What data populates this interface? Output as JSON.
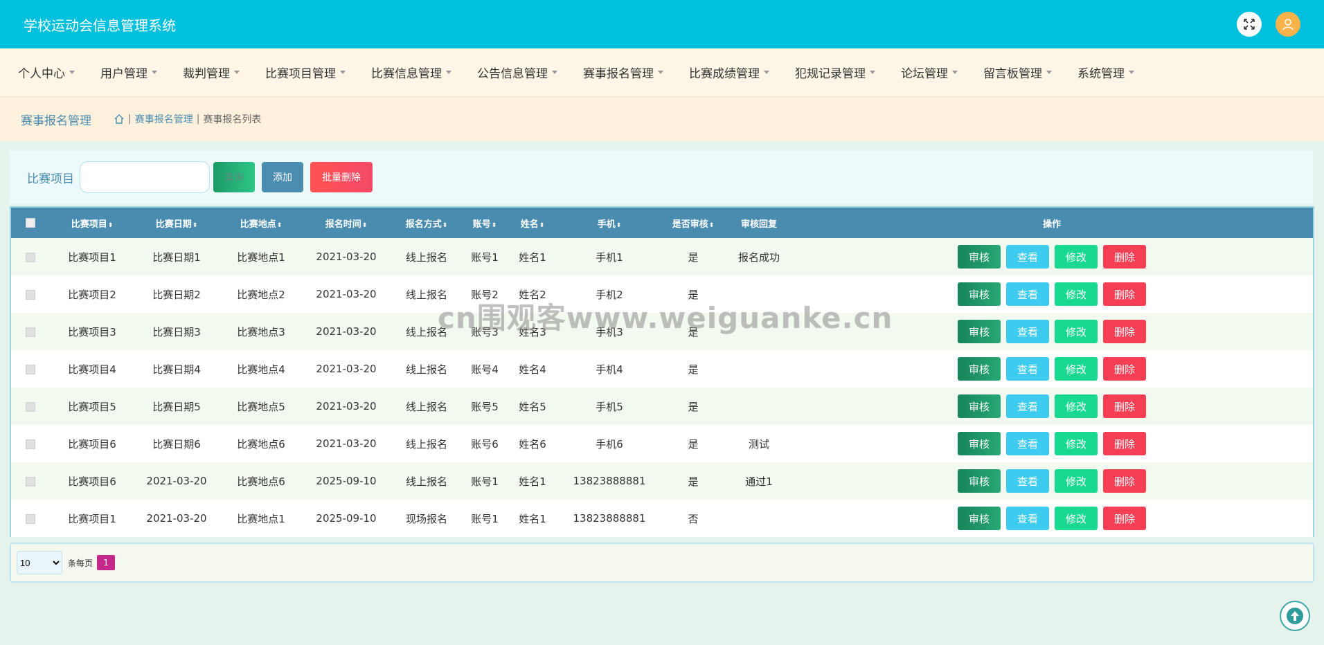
{
  "app": {
    "title": "学校运动会信息管理系统",
    "colors": {
      "header": "#00c0dd",
      "table_header": "#4a8cb0",
      "accent": "#4a8db1"
    }
  },
  "header": {
    "icons": [
      "fullscreen-icon",
      "user-avatar-icon"
    ]
  },
  "menu": [
    {
      "label": "个人中心"
    },
    {
      "label": "用户管理"
    },
    {
      "label": "裁判管理"
    },
    {
      "label": "比赛项目管理"
    },
    {
      "label": "比赛信息管理"
    },
    {
      "label": "公告信息管理"
    },
    {
      "label": "赛事报名管理"
    },
    {
      "label": "比赛成绩管理"
    },
    {
      "label": "犯规记录管理"
    },
    {
      "label": "论坛管理"
    },
    {
      "label": "留言板管理"
    },
    {
      "label": "系统管理"
    }
  ],
  "breadcrumb": {
    "page_title": "赛事报名管理",
    "sep": "|",
    "level1": "赛事报名管理",
    "level2": "赛事报名列表"
  },
  "search": {
    "label": "比赛项目",
    "value": "",
    "query_label": "查询",
    "add_label": "添加",
    "bulk_delete_label": "批量删除"
  },
  "table": {
    "columns": [
      "比赛项目",
      "比赛日期",
      "比赛地点",
      "报名时间",
      "报名方式",
      "账号",
      "姓名",
      "手机",
      "是否审核",
      "审核回复",
      "操作"
    ],
    "sortable": [
      true,
      true,
      true,
      true,
      true,
      true,
      true,
      true,
      true,
      false,
      false
    ],
    "sort_glyph": "⬍",
    "rows": [
      [
        "比赛项目1",
        "比赛日期1",
        "比赛地点1",
        "2021-03-20",
        "线上报名",
        "账号1",
        "姓名1",
        "手机1",
        "是",
        "报名成功"
      ],
      [
        "比赛项目2",
        "比赛日期2",
        "比赛地点2",
        "2021-03-20",
        "线上报名",
        "账号2",
        "姓名2",
        "手机2",
        "是",
        ""
      ],
      [
        "比赛项目3",
        "比赛日期3",
        "比赛地点3",
        "2021-03-20",
        "线上报名",
        "账号3",
        "姓名3",
        "手机3",
        "是",
        ""
      ],
      [
        "比赛项目4",
        "比赛日期4",
        "比赛地点4",
        "2021-03-20",
        "线上报名",
        "账号4",
        "姓名4",
        "手机4",
        "是",
        ""
      ],
      [
        "比赛项目5",
        "比赛日期5",
        "比赛地点5",
        "2021-03-20",
        "线上报名",
        "账号5",
        "姓名5",
        "手机5",
        "是",
        ""
      ],
      [
        "比赛项目6",
        "比赛日期6",
        "比赛地点6",
        "2021-03-20",
        "线上报名",
        "账号6",
        "姓名6",
        "手机6",
        "是",
        "测试"
      ],
      [
        "比赛项目6",
        "2021-03-20",
        "比赛地点6",
        "2025-09-10",
        "线上报名",
        "账号1",
        "姓名1",
        "13823888881",
        "是",
        "通过1"
      ],
      [
        "比赛项目1",
        "2021-03-20",
        "比赛地点1",
        "2025-09-10",
        "现场报名",
        "账号1",
        "姓名1",
        "13823888881",
        "否",
        ""
      ]
    ],
    "actions": [
      "审核",
      "查看",
      "修改",
      "删除"
    ]
  },
  "pager": {
    "page_size": "10",
    "page_size_options": [
      "10"
    ],
    "per_page_label": "条每页",
    "current_page": "1"
  },
  "watermark": "cn围观客www.weiguanke.cn"
}
